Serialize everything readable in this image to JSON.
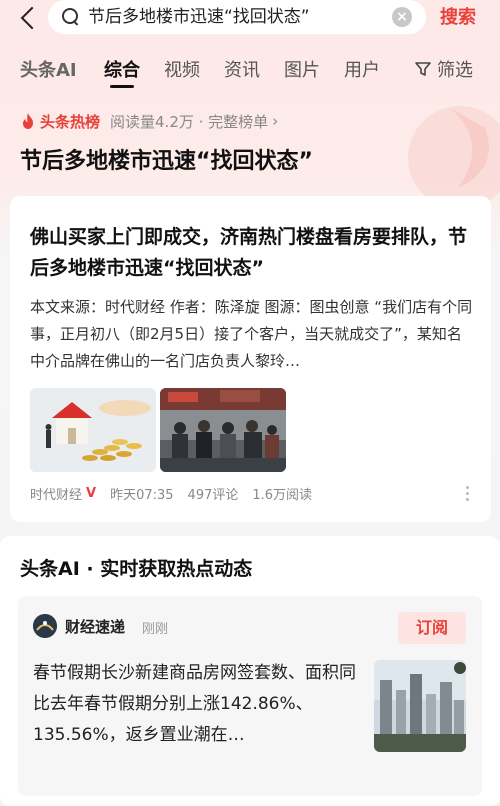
{
  "search": {
    "query": "节后多地楼市迅速“找回状态”",
    "action_label": "搜索"
  },
  "tabs": [
    {
      "label": "头条AI"
    },
    {
      "label": "综合"
    },
    {
      "label": "视频"
    },
    {
      "label": "资讯"
    },
    {
      "label": "图片"
    },
    {
      "label": "用户"
    }
  ],
  "filter_label": "筛选",
  "hot": {
    "brand": "头条热榜",
    "meta": "阅读量4.2万 · 完整榜单",
    "title": "节后多地楼市迅速“找回状态”"
  },
  "article": {
    "title": "佛山买家上门即成交，济南热门楼盘看房要排队，节后多地楼市迅速“找回状态”",
    "summary": "本文来源：时代财经 作者：陈泽旋 图源：图虫创意 “我们店有个同事，正月初八（即2月5日）接了个客户，当天就成交了”，某知名中介品牌在佛山的一名门店负责人黎玲…",
    "source": "时代财经",
    "verified": "V",
    "time": "昨天07:35",
    "comments": "497评论",
    "reads": "1.6万阅读"
  },
  "ai": {
    "header": "头条AI · 实时获取热点动态",
    "source": "财经速递",
    "time": "刚刚",
    "subscribe_label": "订阅",
    "text": "春节假期长沙新建商品房网签套数、面积同比去年春节假期分别上涨142.86%、135.56%，返乡置业潮在…"
  },
  "colors": {
    "accent": "#e8413a",
    "subscribe_bg": "#fde3e1"
  },
  "icons": [
    "back-arrow-icon",
    "search-icon",
    "clear-icon",
    "filter-icon",
    "fire-icon",
    "chevron-right-icon",
    "more-icon",
    "avatar-icon"
  ]
}
